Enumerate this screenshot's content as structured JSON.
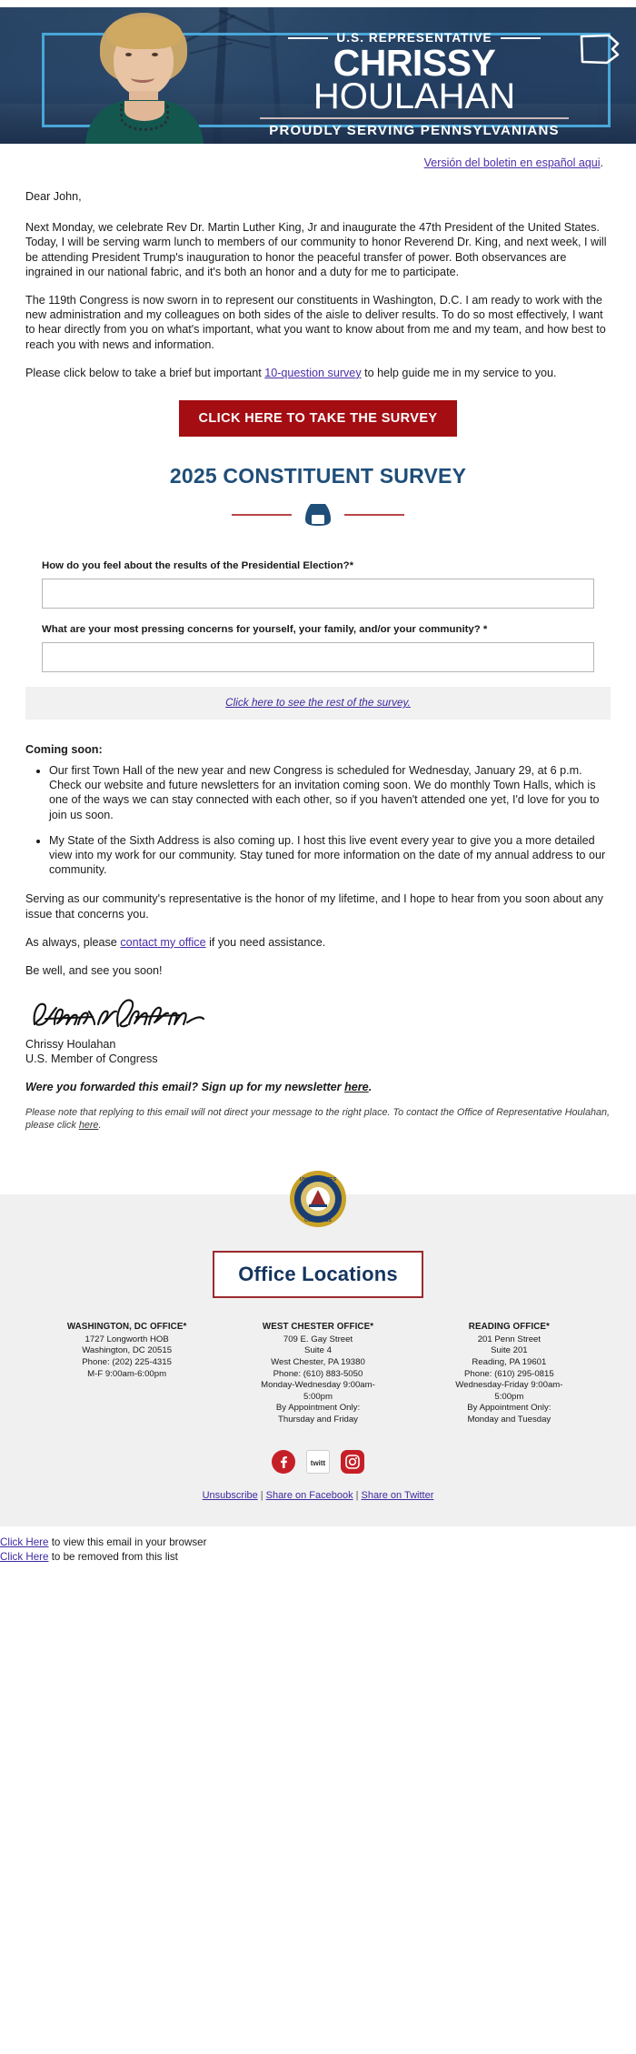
{
  "banner": {
    "eyebrow": "U.S. REPRESENTATIVE",
    "first_name": "CHRISSY",
    "last_name": "HOULAHAN",
    "tagline": "PROUDLY SERVING PENNSYLVANIANS",
    "frame_color": "#49a6d8",
    "photo_alt": "portrait-chrissy-houlahan"
  },
  "spanish": {
    "link_text": "Versión del boletin en español aqui",
    "trailing": "."
  },
  "letter": {
    "greeting": "Dear John,",
    "p1": "Next Monday, we celebrate Rev Dr. Martin Luther King, Jr and inaugurate the 47th President of the United States. Today, I will be serving warm lunch to members of our community to honor Reverend Dr. King, and next week, I will be attending President Trump's inauguration to honor the peaceful transfer of power. Both observances are ingrained in our national fabric, and it's both an honor and a duty for me to participate.",
    "p2": "The 119th Congress is now sworn in to represent our constituents in Washington, D.C. I am ready to work with the new administration and my colleagues on both sides of the aisle to deliver results. To do so most effectively, I want to hear directly from you on what's important, what you want to know about from me and my team, and how best to reach you with news and information.",
    "p3_before": "Please click below to take a brief but important ",
    "p3_link": "10-question survey",
    "p3_after": " to help guide me in my service to you."
  },
  "cta": {
    "label": "CLICK HERE TO TAKE THE SURVEY",
    "color": "#a40d12"
  },
  "survey": {
    "title": "2025 CONSTITUENT SURVEY",
    "divider_color": "#b8474b",
    "keystone_color": "#1f4e79",
    "questions": [
      {
        "label": "How do you feel about the results of the Presidential Election?*",
        "value": "",
        "placeholder": ""
      },
      {
        "label": "What are your most pressing concerns for yourself, your family, and/or your community? *",
        "value": "",
        "placeholder": ""
      }
    ],
    "rest_link": "Click here to see the rest of the survey."
  },
  "coming_soon": {
    "heading": "Coming soon:",
    "items": [
      "Our first Town Hall of the new year and new Congress is scheduled for Wednesday, January 29, at 6 p.m. Check our website and future newsletters for an invitation coming soon. We do monthly Town Halls, which is one of the ways we can stay connected with each other, so if you haven't attended one yet, I'd love for you to join us soon.",
      "My State of the Sixth Address is also coming up. I host this live event every year to give you a more detailed view into my work for our community. Stay tuned for more information on the date of my annual address to our community."
    ]
  },
  "closing": {
    "p1": "Serving as our community's representative is the honor of my lifetime, and I hope to hear from you soon about any issue that concerns you.",
    "p2_before": "As always, please ",
    "p2_link": "contact my office",
    "p2_after": " if you need assistance.",
    "p3": "Be well, and see you soon!",
    "signature_alt": "signature-chrissy-houlahan",
    "name": "Chrissy Houlahan",
    "title": "U.S. Member of Congress",
    "forward_before": "Were you forwarded this email? Sign up for my newsletter ",
    "forward_link": "here",
    "forward_after": ".",
    "note_before": "Please note that replying to this email will not direct your message to the right place. To contact the Office of Representative Houlahan, please click ",
    "note_link": "here",
    "note_after": "."
  },
  "seal": {
    "top_text": "UNITED STATES",
    "bottom_text": "CONGRESS",
    "alt": "congress-seal"
  },
  "footer": {
    "box_title": "Office Locations",
    "offices": [
      {
        "name": "WASHINGTON, DC OFFICE*",
        "lines": [
          "1727 Longworth HOB",
          "Washington, DC 20515",
          "Phone: (202) 225-4315",
          "M-F 9:00am-6:00pm"
        ]
      },
      {
        "name": "WEST CHESTER OFFICE*",
        "lines": [
          "709 E. Gay Street",
          "Suite 4",
          "West Chester, PA 19380",
          "Phone: (610) 883-5050",
          "Monday-Wednesday 9:00am-",
          "5:00pm",
          "By Appointment Only:",
          "Thursday and Friday"
        ]
      },
      {
        "name": "READING OFFICE*",
        "lines": [
          "201 Penn Street",
          "Suite 201",
          "Reading, PA 19601",
          "Phone: (610) 295-0815",
          "Wednesday-Friday 9:00am-",
          "5:00pm",
          "By Appointment Only:",
          "Monday and Tuesday"
        ]
      }
    ],
    "socials": [
      {
        "name": "facebook-icon",
        "glyph": "f"
      },
      {
        "name": "twitter-icon",
        "glyph": "twitt"
      },
      {
        "name": "instagram-icon",
        "glyph": ""
      }
    ],
    "links": {
      "unsubscribe": "Unsubscribe",
      "share_facebook": "Share on Facebook",
      "share_twitter": "Share on Twitter",
      "separator": "|"
    }
  },
  "tail": {
    "line1_link": "Click Here",
    "line1_text": " to view this email in your browser",
    "line2_link": "Click Here",
    "line2_text": " to be removed from this list"
  }
}
